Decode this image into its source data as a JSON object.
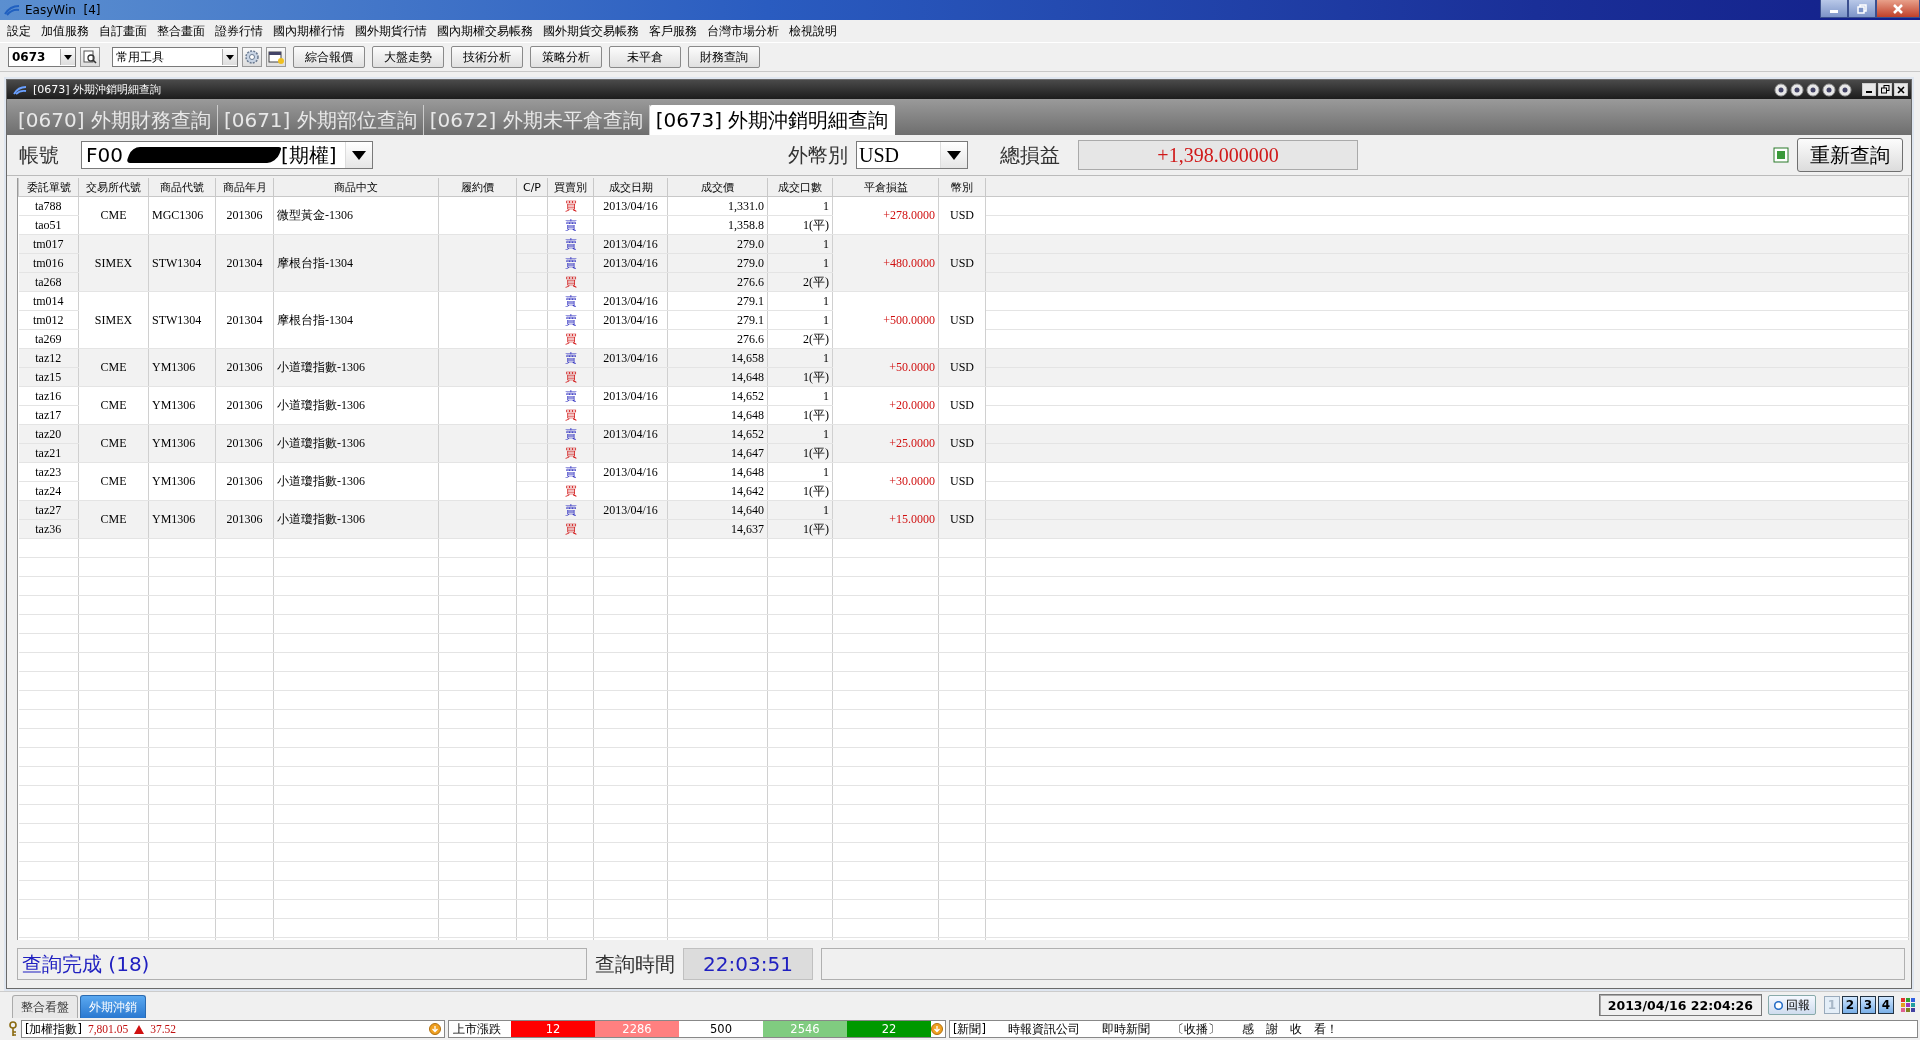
{
  "window": {
    "title": "EasyWin  [4]"
  },
  "menu": [
    "設定",
    "加值服務",
    "自訂畫面",
    "整合畫面",
    "證券行情",
    "國內期權行情",
    "國外期貨行情",
    "國內期權交易帳務",
    "國外期貨交易帳務",
    "客戶服務",
    "台灣市場分析",
    "檢視說明"
  ],
  "toolbar": {
    "code": "0673",
    "tool_group": "常用工具",
    "buttons": [
      "綜合報價",
      "大盤走勢",
      "技術分析",
      "策略分析",
      "未平倉",
      "財務查詢"
    ]
  },
  "subwindow": {
    "title": "[0673] 外期沖銷明細查詢"
  },
  "tabs": [
    {
      "label": "[0670] 外期財務查詢",
      "selected": false
    },
    {
      "label": "[0671] 外期部位查詢",
      "selected": false
    },
    {
      "label": "[0672] 外期未平倉查詢",
      "selected": false
    },
    {
      "label": "[0673] 外期沖銷明細查詢",
      "selected": true
    }
  ],
  "filter": {
    "account_label": "帳號",
    "account_prefix": "F00",
    "account_suffix": "[期權]",
    "currency_label": "外幣別",
    "currency": "USD",
    "total_label": "總損益",
    "total": "+1,398.000000",
    "requery_button": "重新查詢"
  },
  "table": {
    "columns": [
      "委託單號",
      "交易所代號",
      "商品代號",
      "商品年月",
      "商品中文",
      "履約價",
      "C/P",
      "買賣別",
      "成交日期",
      "成交價",
      "成交口數",
      "平倉損益",
      "幣別"
    ],
    "groups": [
      {
        "exchange": "CME",
        "code": "MGC1306",
        "month": "201306",
        "name": "微型黃金-1306",
        "pnl": "+278.0000",
        "currency": "USD",
        "rows": [
          {
            "order": "ta788",
            "side": "買",
            "kind": "buy",
            "date": "2013/04/16",
            "price": "1,331.0",
            "qty": "1"
          },
          {
            "order": "tao51",
            "side": "賣",
            "kind": "sell",
            "price": "1,358.8",
            "qty": "1(平)"
          }
        ]
      },
      {
        "exchange": "SIMEX",
        "code": "STW1304",
        "month": "201304",
        "name": "摩根台指-1304",
        "pnl": "+480.0000",
        "currency": "USD",
        "rows": [
          {
            "order": "tm017",
            "side": "賣",
            "kind": "sell",
            "date": "2013/04/16",
            "price": "279.0",
            "qty": "1"
          },
          {
            "order": "tm016",
            "side": "賣",
            "kind": "sell",
            "date": "2013/04/16",
            "price": "279.0",
            "qty": "1"
          },
          {
            "order": "ta268",
            "side": "買",
            "kind": "buy",
            "price": "276.6",
            "qty": "2(平)"
          }
        ]
      },
      {
        "exchange": "SIMEX",
        "code": "STW1304",
        "month": "201304",
        "name": "摩根台指-1304",
        "pnl": "+500.0000",
        "currency": "USD",
        "rows": [
          {
            "order": "tm014",
            "side": "賣",
            "kind": "sell",
            "date": "2013/04/16",
            "price": "279.1",
            "qty": "1"
          },
          {
            "order": "tm012",
            "side": "賣",
            "kind": "sell",
            "date": "2013/04/16",
            "price": "279.1",
            "qty": "1"
          },
          {
            "order": "ta269",
            "side": "買",
            "kind": "buy",
            "price": "276.6",
            "qty": "2(平)"
          }
        ]
      },
      {
        "exchange": "CME",
        "code": "YM1306",
        "month": "201306",
        "name": "小道瓊指數-1306",
        "pnl": "+50.0000",
        "currency": "USD",
        "rows": [
          {
            "order": "taz12",
            "side": "賣",
            "kind": "sell",
            "date": "2013/04/16",
            "price": "14,658",
            "qty": "1"
          },
          {
            "order": "taz15",
            "side": "買",
            "kind": "buy",
            "price": "14,648",
            "qty": "1(平)"
          }
        ]
      },
      {
        "exchange": "CME",
        "code": "YM1306",
        "month": "201306",
        "name": "小道瓊指數-1306",
        "pnl": "+20.0000",
        "currency": "USD",
        "rows": [
          {
            "order": "taz16",
            "side": "賣",
            "kind": "sell",
            "date": "2013/04/16",
            "price": "14,652",
            "qty": "1"
          },
          {
            "order": "taz17",
            "side": "買",
            "kind": "buy",
            "price": "14,648",
            "qty": "1(平)"
          }
        ]
      },
      {
        "exchange": "CME",
        "code": "YM1306",
        "month": "201306",
        "name": "小道瓊指數-1306",
        "pnl": "+25.0000",
        "currency": "USD",
        "rows": [
          {
            "order": "taz20",
            "side": "賣",
            "kind": "sell",
            "date": "2013/04/16",
            "price": "14,652",
            "qty": "1"
          },
          {
            "order": "taz21",
            "side": "買",
            "kind": "buy",
            "price": "14,647",
            "qty": "1(平)"
          }
        ]
      },
      {
        "exchange": "CME",
        "code": "YM1306",
        "month": "201306",
        "name": "小道瓊指數-1306",
        "pnl": "+30.0000",
        "currency": "USD",
        "rows": [
          {
            "order": "taz23",
            "side": "賣",
            "kind": "sell",
            "date": "2013/04/16",
            "price": "14,648",
            "qty": "1"
          },
          {
            "order": "taz24",
            "side": "買",
            "kind": "buy",
            "price": "14,642",
            "qty": "1(平)"
          }
        ]
      },
      {
        "exchange": "CME",
        "code": "YM1306",
        "month": "201306",
        "name": "小道瓊指數-1306",
        "pnl": "+15.0000",
        "currency": "USD",
        "rows": [
          {
            "order": "taz27",
            "side": "賣",
            "kind": "sell",
            "date": "2013/04/16",
            "price": "14,640",
            "qty": "1"
          },
          {
            "order": "taz36",
            "side": "買",
            "kind": "buy",
            "price": "14,637",
            "qty": "1(平)"
          }
        ]
      }
    ]
  },
  "status": {
    "message": "查詢完成 (18)",
    "time_label": "查詢時間",
    "time": "22:03:51"
  },
  "window_tabs": [
    {
      "label": "整合看盤",
      "selected": false
    },
    {
      "label": "外期沖銷",
      "selected": true
    }
  ],
  "clock": "2013/04/16 22:04:26",
  "report_button": "回報",
  "pages": [
    {
      "label": "1",
      "selected": true
    },
    {
      "label": "2",
      "selected": false
    },
    {
      "label": "3",
      "selected": false
    },
    {
      "label": "4",
      "selected": false
    }
  ],
  "ticker": {
    "index_label": "[加權指數]",
    "index_value": "7,801.05",
    "change": "37.52",
    "breadth_label": "上市漲跌",
    "breadth": [
      {
        "value": "12",
        "color": "#ff0000"
      },
      {
        "value": "2286",
        "color": "#ff8080"
      },
      {
        "value": "500",
        "color": "#ffffff"
      },
      {
        "value": "2546",
        "color": "#80cc80"
      },
      {
        "value": "22",
        "color": "#009900"
      }
    ],
    "news": [
      "[新聞]",
      "時報資訊公司",
      "即時新聞",
      "〔收播〕",
      "感　謝　收　看！"
    ]
  }
}
